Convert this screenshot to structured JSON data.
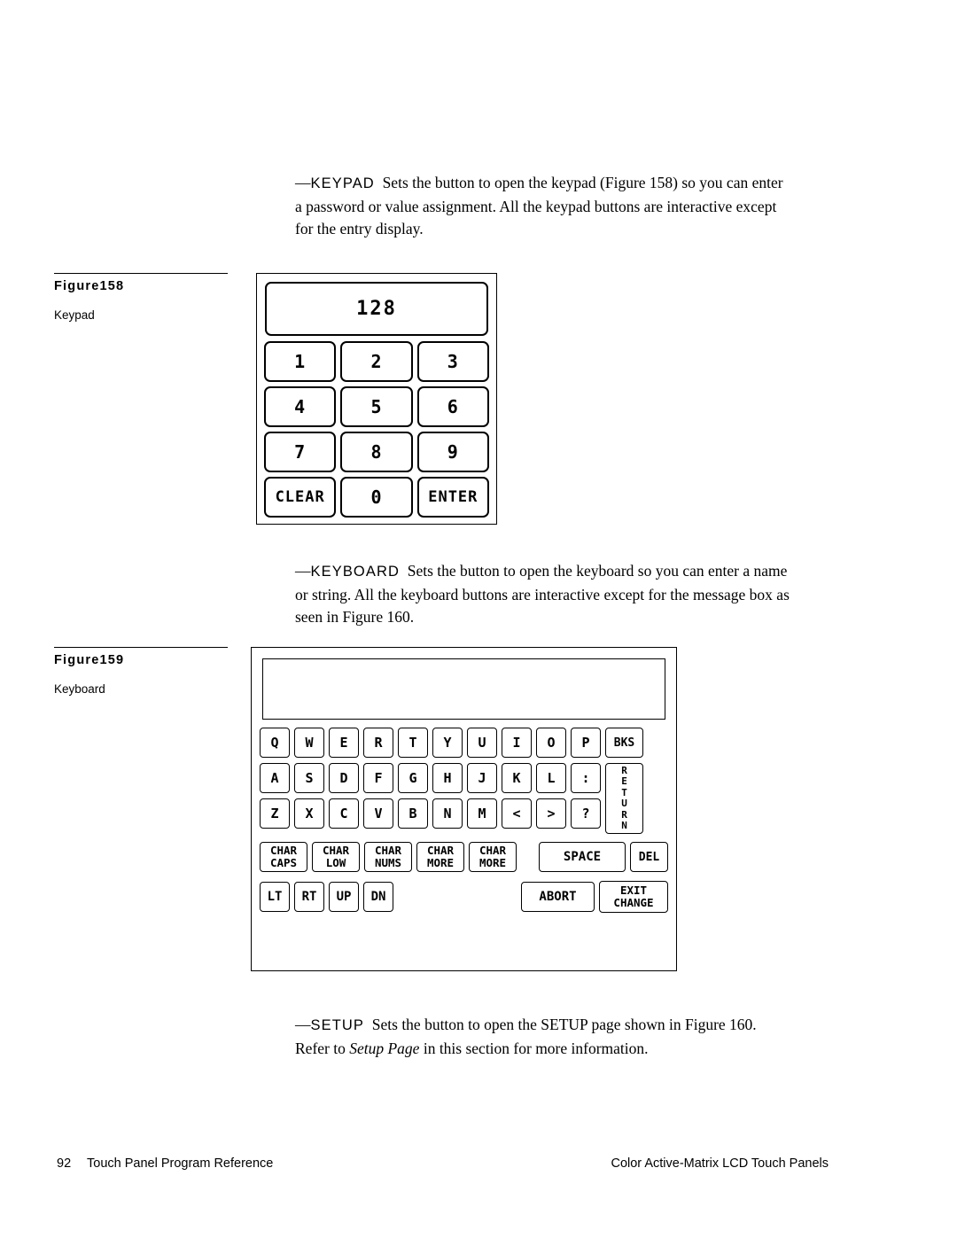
{
  "page": {
    "number": "92",
    "footer_left": "Touch Panel Program Reference",
    "footer_right": "Color Active-Matrix LCD Touch Panels"
  },
  "paragraphs": {
    "keypad": {
      "dash": "—",
      "keyword": "KEYPAD",
      "text": "Sets the button to open the keypad (Figure 158) so you can enter a password or value assignment. All the keypad buttons are interactive except for the entry display."
    },
    "keyboard": {
      "dash": "—",
      "keyword": "KEYBOARD",
      "text": "Sets the button to open the keyboard so you can enter a name or string. All the keyboard buttons are interactive except for the message box as seen in Figure 160."
    },
    "setup": {
      "dash": "—",
      "keyword": "SETUP",
      "text_before": "Sets the button to open the SETUP page shown in Figure 160. Refer to ",
      "italic": "Setup Page",
      "text_after": " in this section for more information."
    }
  },
  "figures": {
    "keypad": {
      "number": "Figure158",
      "label": "Keypad"
    },
    "keyboard": {
      "number": "Figure159",
      "label": "Keyboard"
    }
  },
  "keypad": {
    "display_value": "128",
    "rows": [
      [
        "1",
        "2",
        "3"
      ],
      [
        "4",
        "5",
        "6"
      ],
      [
        "7",
        "8",
        "9"
      ],
      [
        "CLEAR",
        "0",
        "ENTER"
      ]
    ]
  },
  "keyboard": {
    "message_box": "",
    "row1": [
      "Q",
      "W",
      "E",
      "R",
      "T",
      "Y",
      "U",
      "I",
      "O",
      "P"
    ],
    "row1_last": "BKS",
    "row2": [
      "A",
      "S",
      "D",
      "F",
      "G",
      "H",
      "J",
      "K",
      "L",
      ":"
    ],
    "return_key": "RETURN",
    "row3": [
      "Z",
      "X",
      "C",
      "V",
      "B",
      "N",
      "M",
      "<",
      ">",
      "?"
    ],
    "row4": [
      {
        "l1": "CHAR",
        "l2": "CAPS"
      },
      {
        "l1": "CHAR",
        "l2": "LOW"
      },
      {
        "l1": "CHAR",
        "l2": "NUMS"
      },
      {
        "l1": "CHAR",
        "l2": "MORE"
      },
      {
        "l1": "CHAR",
        "l2": "MORE"
      }
    ],
    "space": "SPACE",
    "del": "DEL",
    "row5_arrows": [
      "LT",
      "RT",
      "UP",
      "DN"
    ],
    "abort": "ABORT",
    "exit_change": {
      "l1": "EXIT",
      "l2": "CHANGE"
    }
  }
}
